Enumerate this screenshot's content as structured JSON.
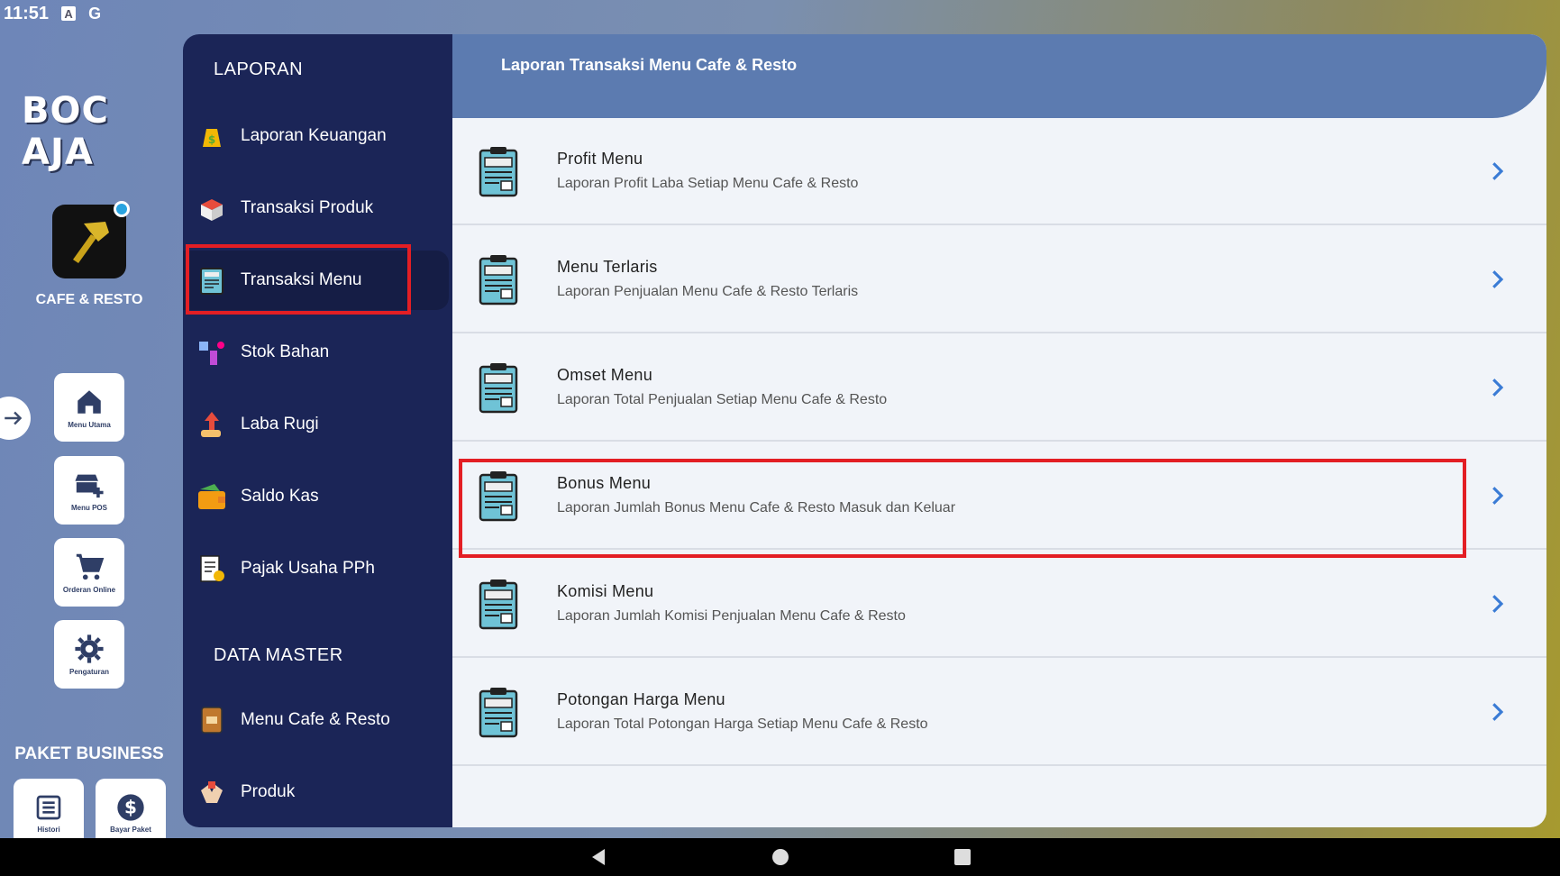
{
  "status": {
    "time": "11:51",
    "icons": [
      "A",
      "G"
    ]
  },
  "rail": {
    "logo": "BOC AJA",
    "app_label": "CAFE & RESTO",
    "buttons": [
      {
        "label": "Menu Utama",
        "icon": "home-icon"
      },
      {
        "label": "Menu POS",
        "icon": "store-icon"
      },
      {
        "label": "Orderan Online",
        "icon": "cart-icon"
      },
      {
        "label": "Pengaturan",
        "icon": "gear-icon"
      }
    ],
    "paket_title": "PAKET BUSINESS",
    "paket_buttons": [
      {
        "label": "Histori",
        "icon": "list-icon"
      },
      {
        "label": "Bayar Paket",
        "icon": "dollar-icon"
      }
    ]
  },
  "nav": {
    "section1": "LAPORAN",
    "items1": [
      {
        "label": "Laporan Keuangan",
        "icon": "money-bag-icon"
      },
      {
        "label": "Transaksi Produk",
        "icon": "box-icon"
      },
      {
        "label": "Transaksi Menu",
        "icon": "menu-board-icon"
      },
      {
        "label": "Stok Bahan",
        "icon": "stock-icon"
      },
      {
        "label": "Laba Rugi",
        "icon": "profit-icon"
      },
      {
        "label": "Saldo Kas",
        "icon": "wallet-icon"
      },
      {
        "label": "Pajak Usaha PPh",
        "icon": "tax-icon"
      }
    ],
    "section2": "DATA MASTER",
    "items2": [
      {
        "label": "Menu Cafe & Resto",
        "icon": "menu-book-icon"
      },
      {
        "label": "Produk",
        "icon": "product-icon"
      }
    ]
  },
  "content": {
    "title": "Laporan Transaksi Menu Cafe & Resto",
    "rows": [
      {
        "title": "Profit Menu",
        "sub": "Laporan Profit Laba Setiap Menu Cafe & Resto"
      },
      {
        "title": "Menu Terlaris",
        "sub": "Laporan Penjualan Menu Cafe & Resto Terlaris"
      },
      {
        "title": "Omset Menu",
        "sub": "Laporan Total Penjualan Setiap Menu Cafe & Resto"
      },
      {
        "title": "Bonus Menu",
        "sub": "Laporan Jumlah Bonus Menu Cafe & Resto Masuk dan Keluar"
      },
      {
        "title": "Komisi Menu",
        "sub": "Laporan Jumlah Komisi Penjualan Menu Cafe & Resto"
      },
      {
        "title": "Potongan Harga Menu",
        "sub": "Laporan Total Potongan Harga Setiap Menu Cafe & Resto"
      }
    ]
  },
  "colors": {
    "nav_bg": "#1b2557",
    "header_bg": "#5c7bb0",
    "highlight": "#e31e24",
    "chevron": "#3a7bd5"
  }
}
